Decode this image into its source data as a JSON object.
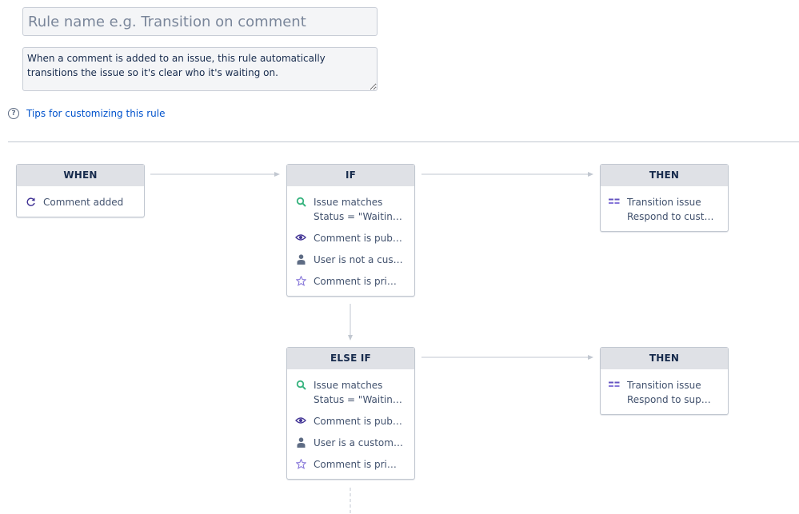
{
  "rule": {
    "name_placeholder": "Rule name e.g. Transition on comment",
    "name_value": "",
    "description": "When a comment is added to an issue, this rule automatically transitions the issue so it's clear who it's waiting on."
  },
  "tips": {
    "label": "Tips for customizing this rule"
  },
  "icons": {
    "trigger": "refresh-icon",
    "issue_matches": "search-icon",
    "comment_public": "eye-icon",
    "user": "user-icon",
    "comment_primary": "star-icon",
    "transition": "transition-icon"
  },
  "colors": {
    "link": "#0052cc",
    "header_bg": "#dfe1e6",
    "search_icon": "#36b37e",
    "eye_icon": "#403294",
    "user_icon": "#5e6c84",
    "star_icon": "#8777d9",
    "transition_icon": "#6554c0"
  },
  "flow": {
    "when": {
      "title": "WHEN",
      "items": [
        {
          "label": "Comment added"
        }
      ]
    },
    "if": {
      "title": "IF",
      "items": [
        {
          "label": "Issue matches",
          "sub": "Status = \"Waiting…"
        },
        {
          "label": "Comment is public"
        },
        {
          "label": "User is not a cust…"
        },
        {
          "label": "Comment is prim…"
        }
      ]
    },
    "then_1": {
      "title": "THEN",
      "items": [
        {
          "label": "Transition issue",
          "sub": "Respond to cust…"
        }
      ]
    },
    "else_if": {
      "title": "ELSE IF",
      "items": [
        {
          "label": "Issue matches",
          "sub": "Status = \"Waiting…"
        },
        {
          "label": "Comment is public"
        },
        {
          "label": "User is a customer"
        },
        {
          "label": "Comment is prim…"
        }
      ]
    },
    "then_2": {
      "title": "THEN",
      "items": [
        {
          "label": "Transition issue",
          "sub": "Respond to supp…"
        }
      ]
    }
  }
}
